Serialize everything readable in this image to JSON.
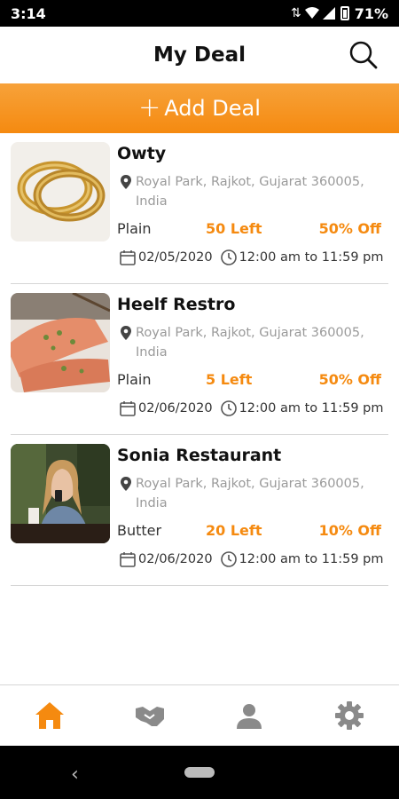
{
  "status_bar": {
    "time": "3:14",
    "battery": "71%"
  },
  "header": {
    "title": "My Deal"
  },
  "add_deal": {
    "label": "Add Deal"
  },
  "deals": [
    {
      "name": "Owty",
      "address": "Royal Park, Rajkot, Gujarat 360005, India",
      "type": "Plain",
      "left": "50 Left",
      "off": "50% Off",
      "date": "02/05/2020",
      "time": "12:00 am to 11:59 pm",
      "image": "bangles-image"
    },
    {
      "name": "Heelf Restro",
      "address": "Royal Park, Rajkot, Gujarat 360005, India",
      "type": "Plain",
      "left": "5 Left",
      "off": "50% Off",
      "date": "02/06/2020",
      "time": "12:00 am to 11:59 pm",
      "image": "salmon-dish-image"
    },
    {
      "name": "Sonia Restaurant",
      "address": "Royal Park, Rajkot, Gujarat 360005, India",
      "type": "Butter",
      "left": "20 Left",
      "off": "10% Off",
      "date": "02/06/2020",
      "time": "12:00 am to 11:59 pm",
      "image": "woman-phone-cafe-image"
    }
  ],
  "bottom_nav": [
    {
      "icon": "home-icon",
      "active": true
    },
    {
      "icon": "handshake-icon",
      "active": false
    },
    {
      "icon": "profile-icon",
      "active": false
    },
    {
      "icon": "settings-icon",
      "active": false
    }
  ],
  "colors": {
    "accent": "#f58a10",
    "inactive_icon": "#8a8a8a",
    "muted_text": "#9a9a9a"
  }
}
